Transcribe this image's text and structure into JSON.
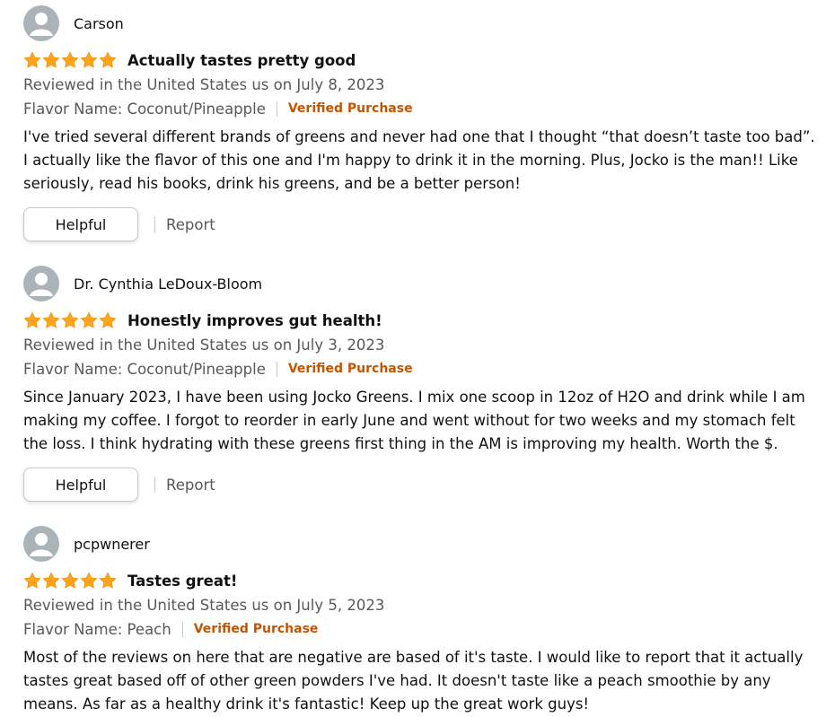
{
  "reviews": [
    {
      "author": "Carson",
      "rating": 5,
      "title": "Actually tastes pretty good",
      "meta": "Reviewed in the United States us on July 8, 2023",
      "flavor": "Flavor Name: Coconut/Pineapple",
      "verified": "Verified Purchase",
      "body": "I've tried several different brands of greens and never had one that I thought “that doesn’t taste too bad”. I actually like the flavor of this one and I'm happy to drink it in the morning. Plus, Jocko is the man!! Like seriously, read his books, drink his greens, and be a better person!",
      "helpful_label": "Helpful",
      "report_label": "Report"
    },
    {
      "author": "Dr. Cynthia LeDoux-Bloom",
      "rating": 5,
      "title": "Honestly improves gut health!",
      "meta": "Reviewed in the United States us on July 3, 2023",
      "flavor": "Flavor Name: Coconut/Pineapple",
      "verified": "Verified Purchase",
      "body": "Since January 2023, I have been using Jocko Greens. I mix one scoop in 12oz of H2O and drink while I am making my coffee. I forgot to reorder in early June and went without for two weeks and my stomach felt the loss. I think hydrating with these greens first thing in the AM is improving my health. Worth the $.",
      "helpful_label": "Helpful",
      "report_label": "Report"
    },
    {
      "author": "pcpwnerer",
      "rating": 5,
      "title": "Tastes great!",
      "meta": "Reviewed in the United States us on July 5, 2023",
      "flavor": "Flavor Name: Peach",
      "verified": "Verified Purchase",
      "body": "Most of the reviews on here that are negative are based of it's taste. I would like to report that it actually tastes great based off of other green powders I've had. It doesn't taste like a peach smoothie by any means. As far as a healthy drink it's fantastic! Keep up the great work guys!"
    }
  ],
  "colors": {
    "star": "#ffa41c",
    "verified": "#c45500",
    "secondary_text": "#565959"
  },
  "icons": {
    "avatar": "default-avatar-icon",
    "star": "star-icon"
  }
}
